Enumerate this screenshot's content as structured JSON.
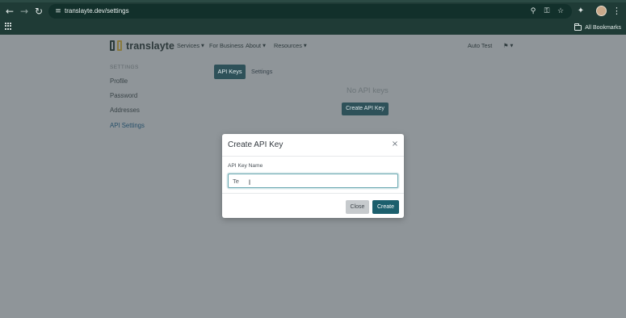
{
  "browser": {
    "url": "translayte.dev/settings",
    "bookmarks_label": "All Bookmarks",
    "icons": {
      "back": "arrow-left-icon",
      "forward": "arrow-right-icon",
      "reload": "reload-icon",
      "site_info": "site-settings-icon",
      "zoom": "zoom-icon",
      "password_key": "key-icon",
      "bookmark_star": "star-icon",
      "extensions": "puzzle-icon",
      "menu": "kebab-menu-icon",
      "apps": "apps-grid-icon",
      "folder": "folder-icon"
    }
  },
  "site": {
    "logo_text": "translayte",
    "nav": [
      {
        "label": "Services",
        "has_caret": true
      },
      {
        "label": "For Business",
        "has_caret": false
      },
      {
        "label": "About",
        "has_caret": true
      },
      {
        "label": "Resources",
        "has_caret": true
      }
    ],
    "user_label": "Auto Test",
    "language_flag": "flag-icon",
    "colors": {
      "primary": "#2e5159",
      "primary_button": "#1c5f6d",
      "page_overlay": "#8f9599"
    }
  },
  "sidebar": {
    "heading": "SETTINGS",
    "items": [
      {
        "label": "Profile",
        "active": false
      },
      {
        "label": "Password",
        "active": false
      },
      {
        "label": "Addresses",
        "active": false
      },
      {
        "label": "API Settings",
        "active": true
      }
    ]
  },
  "main": {
    "tabs": [
      {
        "label": "API Keys",
        "active": true
      },
      {
        "label": "Settings",
        "active": false
      }
    ],
    "empty_text": "No API keys",
    "create_button_label": "Create API Key"
  },
  "modal": {
    "title": "Create API Key",
    "close_icon": "close-icon",
    "field_label": "API Key Name",
    "field_value": "Te",
    "field_placeholder": "",
    "close_button_label": "Close",
    "create_button_label": "Create"
  }
}
